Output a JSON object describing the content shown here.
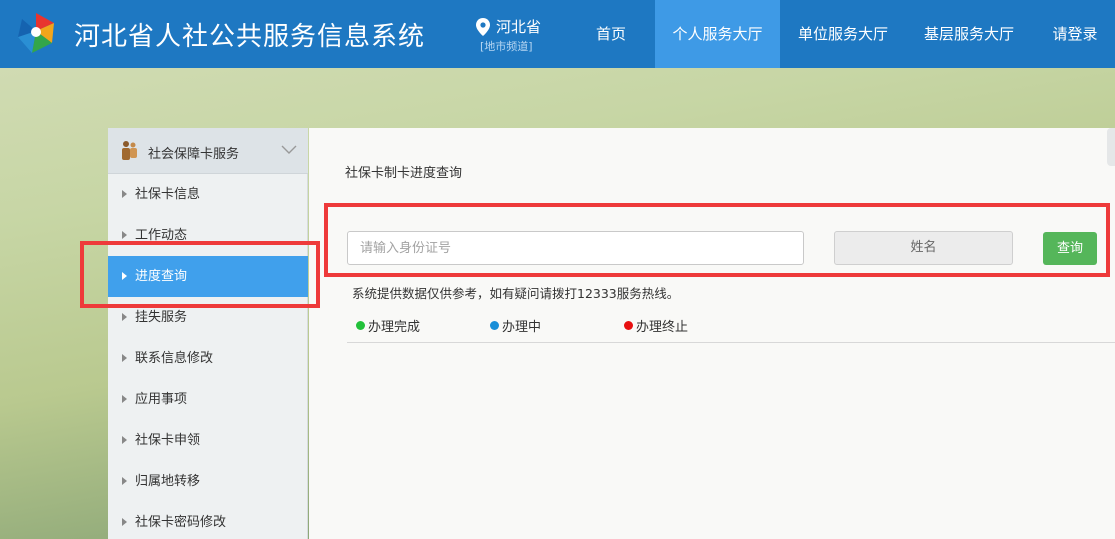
{
  "header": {
    "site_title": "河北省人社公共服务信息系统",
    "region_name": "河北省",
    "region_sub": "[地市频道]",
    "nav": [
      {
        "label": "首页"
      },
      {
        "label": "个人服务大厅"
      },
      {
        "label": "单位服务大厅"
      },
      {
        "label": "基层服务大厅"
      },
      {
        "label": "请登录"
      }
    ],
    "active_nav": "个人服务大厅"
  },
  "sidebar": {
    "group_label": "社会保障卡服务",
    "items": [
      {
        "label": "社保卡信息"
      },
      {
        "label": "工作动态"
      },
      {
        "label": "进度查询"
      },
      {
        "label": "挂失服务"
      },
      {
        "label": "联系信息修改"
      },
      {
        "label": "应用事项"
      },
      {
        "label": "社保卡申领"
      },
      {
        "label": "归属地转移"
      },
      {
        "label": "社保卡密码修改"
      }
    ],
    "active_item": "进度查询"
  },
  "main": {
    "title": "社保卡制卡进度查询",
    "id_placeholder": "请输入身份证号",
    "name_label": "姓名",
    "query_label": "查询",
    "notice": "系统提供数据仅供参考，如有疑问请拨打12333服务热线。",
    "legend": [
      {
        "label": "办理完成",
        "color": "#22c13a"
      },
      {
        "label": "办理中",
        "color": "#1a8fd8"
      },
      {
        "label": "办理终止",
        "color": "#e81010"
      }
    ]
  },
  "colors": {
    "header": "#1e78c2",
    "nav_active": "#3e9ae6",
    "sidebar_active": "#40a0ec",
    "query_button": "#55b65a",
    "highlight": "#ee3a3a"
  }
}
